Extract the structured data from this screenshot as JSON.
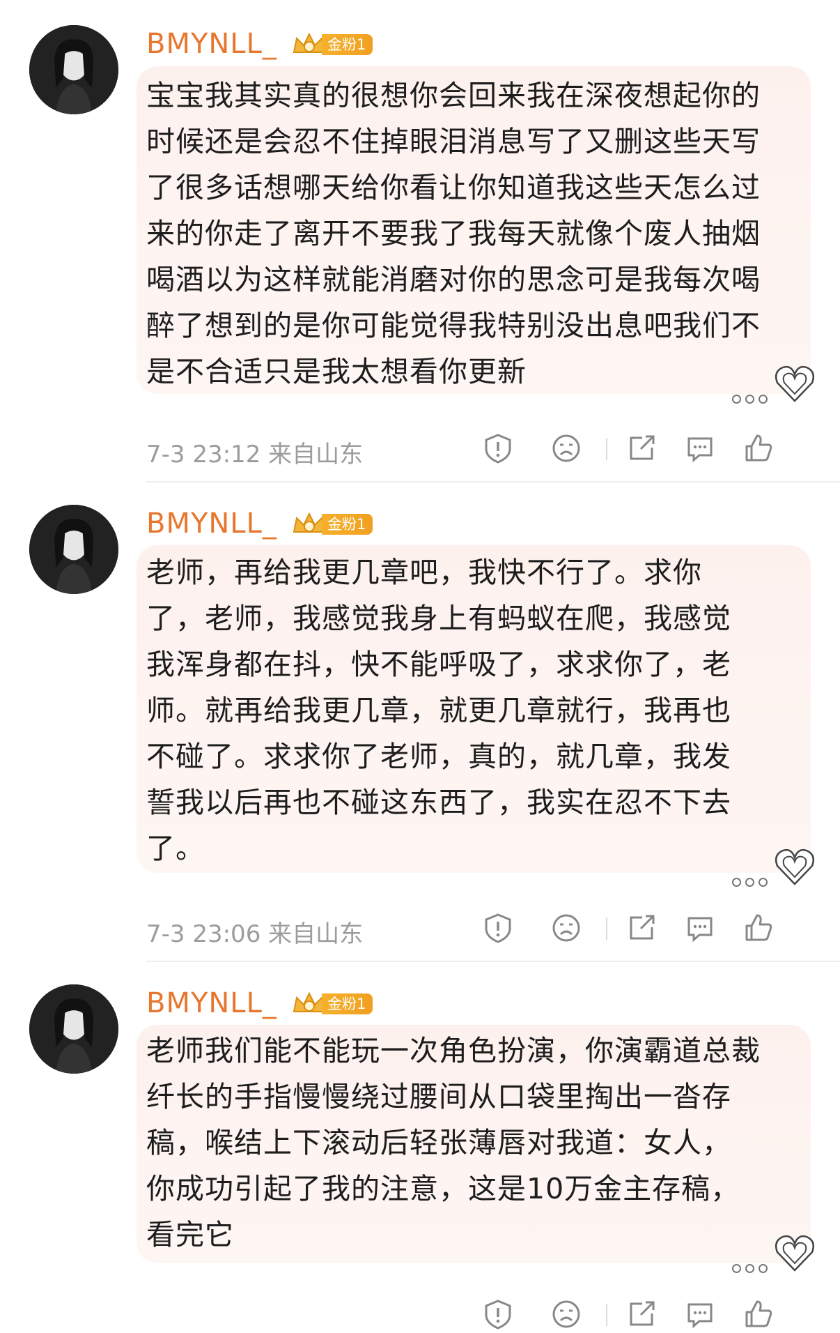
{
  "comments": [
    {
      "username": "BMYNLL_",
      "badge": "金粉1",
      "text": "宝宝我其实真的很想你会回来我在深夜想起你的\n时候还是会忍不住掉眼泪消息写了又删这些天写\n了很多话想哪天给你看让你知道我这些天怎么过\n来的你走了离开不要我了我每天就像个废人抽烟\n喝酒以为这样就能消磨对你的思念可是我每次喝\n醉了想到的是你可能觉得我特别没出息吧我们不\n是不合适只是我太想看你更新",
      "meta": "7-3 23:12 来自山东"
    },
    {
      "username": "BMYNLL_",
      "badge": "金粉1",
      "text": "老师，再给我更几章吧，我快不行了。求你\n了，老师，我感觉我身上有蚂蚁在爬，我感觉\n我浑身都在抖，快不能呼吸了，求求你了，老\n师。就再给我更几章，就更几章就行，我再也\n不碰了。求求你了老师，真的，就几章，我发\n誓我以后再也不碰这东西了，我实在忍不下去\n了。",
      "meta": "7-3 23:06 来自山东"
    },
    {
      "username": "BMYNLL_",
      "badge": "金粉1",
      "text": "老师我们能不能玩一次角色扮演，你演霸道总裁\n纤长的手指慢慢绕过腰间从口袋里掏出一沓存\n稿，喉结上下滚动后轻张薄唇对我道：女人，\n你成功引起了我的注意，这是10万金主存稿，\n看完它",
      "meta": ""
    }
  ],
  "icons": [
    "report-icon",
    "dislike-icon",
    "share-icon",
    "comment-icon",
    "like-icon"
  ],
  "colors": {
    "username": "#e8772e",
    "badge": "#f6b02c",
    "bubble": "#fdf1ee",
    "meta": "#9c9c9c"
  }
}
